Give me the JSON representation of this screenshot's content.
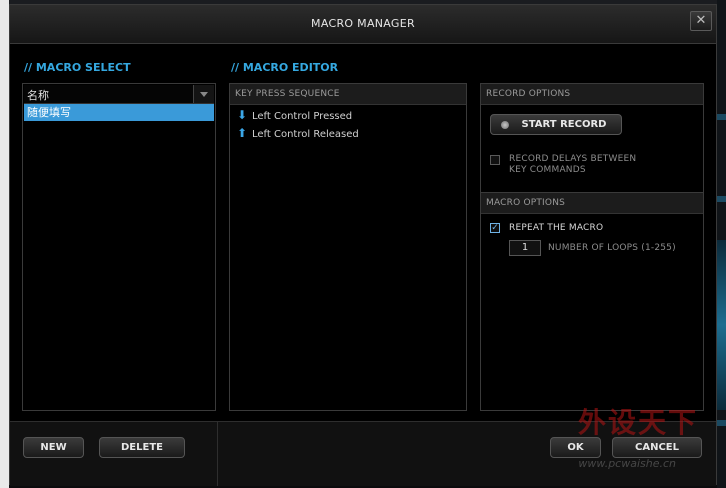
{
  "window": {
    "title": "MACRO MANAGER",
    "close_glyph": "✕"
  },
  "macro_select": {
    "heading": "// MACRO SELECT",
    "column_header": "名称",
    "items": [
      "随便填写"
    ]
  },
  "macro_editor": {
    "heading": "// MACRO EDITOR",
    "sequence_header": "KEY PRESS SEQUENCE",
    "sequence": [
      {
        "icon": "arrow-down-icon",
        "glyph": "⬇",
        "label": "Left Control Pressed"
      },
      {
        "icon": "arrow-up-icon",
        "glyph": "⬆",
        "label": "Left Control Released"
      }
    ]
  },
  "record_options": {
    "header": "RECORD OPTIONS",
    "start_record_label": "START RECORD",
    "record_delays_label_line1": "RECORD DELAYS BETWEEN",
    "record_delays_label_line2": "KEY COMMANDS",
    "record_delays_checked": false
  },
  "macro_options": {
    "header": "MACRO OPTIONS",
    "repeat_label": "REPEAT THE MACRO",
    "repeat_checked": true,
    "check_glyph": "✓",
    "loops_value": "1",
    "loops_label": "NUMBER OF LOOPS (1-255)"
  },
  "buttons": {
    "new": "NEW",
    "delete": "DELETE",
    "ok": "OK",
    "cancel": "CANCEL"
  },
  "watermark": {
    "text": "外设天下",
    "url": "www.pcwaishe.cn"
  },
  "colors": {
    "accent": "#35a8e0",
    "selection": "#3a9ad9",
    "background": "#000000"
  }
}
